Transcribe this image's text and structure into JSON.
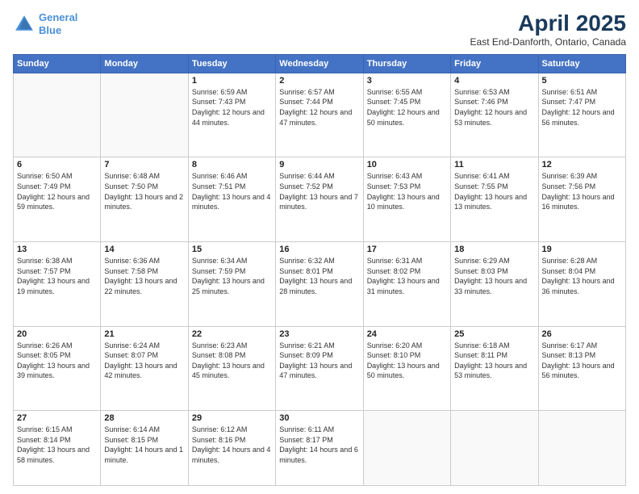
{
  "logo": {
    "line1": "General",
    "line2": "Blue"
  },
  "title": "April 2025",
  "location": "East End-Danforth, Ontario, Canada",
  "days_of_week": [
    "Sunday",
    "Monday",
    "Tuesday",
    "Wednesday",
    "Thursday",
    "Friday",
    "Saturday"
  ],
  "weeks": [
    [
      {
        "day": "",
        "info": ""
      },
      {
        "day": "",
        "info": ""
      },
      {
        "day": "1",
        "info": "Sunrise: 6:59 AM\nSunset: 7:43 PM\nDaylight: 12 hours and 44 minutes."
      },
      {
        "day": "2",
        "info": "Sunrise: 6:57 AM\nSunset: 7:44 PM\nDaylight: 12 hours and 47 minutes."
      },
      {
        "day": "3",
        "info": "Sunrise: 6:55 AM\nSunset: 7:45 PM\nDaylight: 12 hours and 50 minutes."
      },
      {
        "day": "4",
        "info": "Sunrise: 6:53 AM\nSunset: 7:46 PM\nDaylight: 12 hours and 53 minutes."
      },
      {
        "day": "5",
        "info": "Sunrise: 6:51 AM\nSunset: 7:47 PM\nDaylight: 12 hours and 56 minutes."
      }
    ],
    [
      {
        "day": "6",
        "info": "Sunrise: 6:50 AM\nSunset: 7:49 PM\nDaylight: 12 hours and 59 minutes."
      },
      {
        "day": "7",
        "info": "Sunrise: 6:48 AM\nSunset: 7:50 PM\nDaylight: 13 hours and 2 minutes."
      },
      {
        "day": "8",
        "info": "Sunrise: 6:46 AM\nSunset: 7:51 PM\nDaylight: 13 hours and 4 minutes."
      },
      {
        "day": "9",
        "info": "Sunrise: 6:44 AM\nSunset: 7:52 PM\nDaylight: 13 hours and 7 minutes."
      },
      {
        "day": "10",
        "info": "Sunrise: 6:43 AM\nSunset: 7:53 PM\nDaylight: 13 hours and 10 minutes."
      },
      {
        "day": "11",
        "info": "Sunrise: 6:41 AM\nSunset: 7:55 PM\nDaylight: 13 hours and 13 minutes."
      },
      {
        "day": "12",
        "info": "Sunrise: 6:39 AM\nSunset: 7:56 PM\nDaylight: 13 hours and 16 minutes."
      }
    ],
    [
      {
        "day": "13",
        "info": "Sunrise: 6:38 AM\nSunset: 7:57 PM\nDaylight: 13 hours and 19 minutes."
      },
      {
        "day": "14",
        "info": "Sunrise: 6:36 AM\nSunset: 7:58 PM\nDaylight: 13 hours and 22 minutes."
      },
      {
        "day": "15",
        "info": "Sunrise: 6:34 AM\nSunset: 7:59 PM\nDaylight: 13 hours and 25 minutes."
      },
      {
        "day": "16",
        "info": "Sunrise: 6:32 AM\nSunset: 8:01 PM\nDaylight: 13 hours and 28 minutes."
      },
      {
        "day": "17",
        "info": "Sunrise: 6:31 AM\nSunset: 8:02 PM\nDaylight: 13 hours and 31 minutes."
      },
      {
        "day": "18",
        "info": "Sunrise: 6:29 AM\nSunset: 8:03 PM\nDaylight: 13 hours and 33 minutes."
      },
      {
        "day": "19",
        "info": "Sunrise: 6:28 AM\nSunset: 8:04 PM\nDaylight: 13 hours and 36 minutes."
      }
    ],
    [
      {
        "day": "20",
        "info": "Sunrise: 6:26 AM\nSunset: 8:05 PM\nDaylight: 13 hours and 39 minutes."
      },
      {
        "day": "21",
        "info": "Sunrise: 6:24 AM\nSunset: 8:07 PM\nDaylight: 13 hours and 42 minutes."
      },
      {
        "day": "22",
        "info": "Sunrise: 6:23 AM\nSunset: 8:08 PM\nDaylight: 13 hours and 45 minutes."
      },
      {
        "day": "23",
        "info": "Sunrise: 6:21 AM\nSunset: 8:09 PM\nDaylight: 13 hours and 47 minutes."
      },
      {
        "day": "24",
        "info": "Sunrise: 6:20 AM\nSunset: 8:10 PM\nDaylight: 13 hours and 50 minutes."
      },
      {
        "day": "25",
        "info": "Sunrise: 6:18 AM\nSunset: 8:11 PM\nDaylight: 13 hours and 53 minutes."
      },
      {
        "day": "26",
        "info": "Sunrise: 6:17 AM\nSunset: 8:13 PM\nDaylight: 13 hours and 56 minutes."
      }
    ],
    [
      {
        "day": "27",
        "info": "Sunrise: 6:15 AM\nSunset: 8:14 PM\nDaylight: 13 hours and 58 minutes."
      },
      {
        "day": "28",
        "info": "Sunrise: 6:14 AM\nSunset: 8:15 PM\nDaylight: 14 hours and 1 minute."
      },
      {
        "day": "29",
        "info": "Sunrise: 6:12 AM\nSunset: 8:16 PM\nDaylight: 14 hours and 4 minutes."
      },
      {
        "day": "30",
        "info": "Sunrise: 6:11 AM\nSunset: 8:17 PM\nDaylight: 14 hours and 6 minutes."
      },
      {
        "day": "",
        "info": ""
      },
      {
        "day": "",
        "info": ""
      },
      {
        "day": "",
        "info": ""
      }
    ]
  ]
}
